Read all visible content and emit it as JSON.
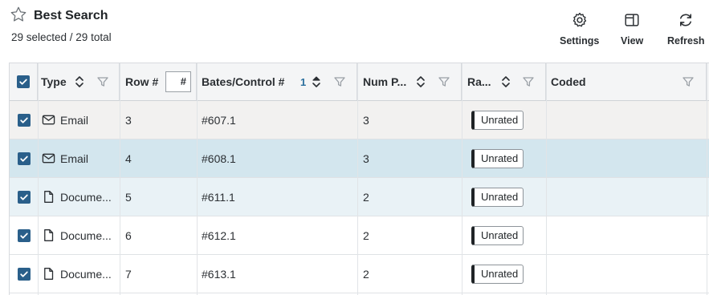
{
  "header": {
    "title": "Best Search",
    "selection_summary": "29 selected / 29 total",
    "favorite_icon": "star-outline-icon"
  },
  "toolbar": {
    "settings_label": "Settings",
    "view_label": "View",
    "refresh_label": "Refresh"
  },
  "columns": {
    "type": "Type",
    "row_num": "Row #",
    "row_num_placeholder": "#",
    "bates": "Bates/Control #",
    "bates_sort_rank": "1",
    "num_pages": "Num P...",
    "rating": "Ra...",
    "coded": "Coded"
  },
  "rows": [
    {
      "type": "Email",
      "type_icon": "mail-icon",
      "row": "3",
      "bates": "#607.1",
      "pages": "3",
      "rating": "Unrated",
      "coded": "",
      "state": "default"
    },
    {
      "type": "Email",
      "type_icon": "mail-icon",
      "row": "4",
      "bates": "#608.1",
      "pages": "3",
      "rating": "Unrated",
      "coded": "",
      "state": "active"
    },
    {
      "type": "Docume...",
      "type_icon": "document-icon",
      "row": "5",
      "bates": "#611.1",
      "pages": "2",
      "rating": "Unrated",
      "coded": "",
      "state": "hover"
    },
    {
      "type": "Docume...",
      "type_icon": "document-icon",
      "row": "6",
      "bates": "#612.1",
      "pages": "2",
      "rating": "Unrated",
      "coded": "",
      "state": "default"
    },
    {
      "type": "Docume...",
      "type_icon": "document-icon",
      "row": "7",
      "bates": "#613.1",
      "pages": "2",
      "rating": "Unrated",
      "coded": "",
      "state": "default"
    }
  ],
  "colors": {
    "checkbox": "#2a5f8a",
    "active_row": "#d3e6ee",
    "hover_row": "#e9f2f6",
    "default_row_first": "#f2f1f0",
    "sort_rank": "#2a6f9e"
  }
}
